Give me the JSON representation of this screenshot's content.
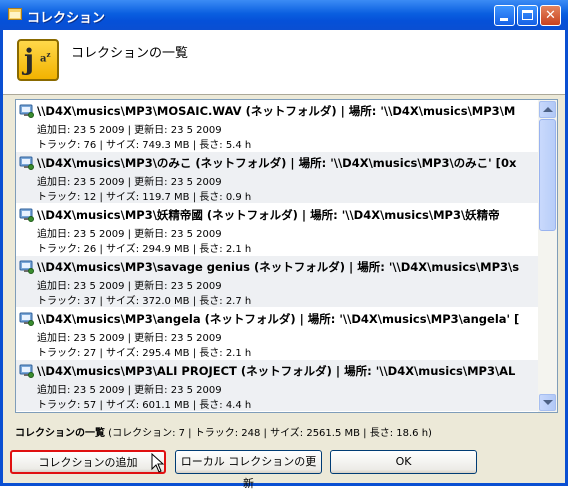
{
  "window": {
    "title": "コレクション"
  },
  "header": {
    "title": "コレクションの一覧",
    "icon": "jaz-app-icon"
  },
  "collections": [
    {
      "path": "\\\\D4X\\musics\\MP3\\MOSAIC.WAV (ネットフォルダ) | 場所: '\\\\D4X\\musics\\MP3\\M",
      "dates": "追加日: 23 5 2009 | 更新日: 23 5 2009",
      "stats": "トラック: 76 | サイズ: 749.3 MB | 長さ: 5.4 h"
    },
    {
      "path": "\\\\D4X\\musics\\MP3\\のみこ (ネットフォルダ) | 場所: '\\\\D4X\\musics\\MP3\\のみこ' [0x",
      "dates": "追加日: 23 5 2009 | 更新日: 23 5 2009",
      "stats": "トラック: 12 | サイズ: 119.7 MB | 長さ: 0.9 h"
    },
    {
      "path": "\\\\D4X\\musics\\MP3\\妖精帝國 (ネットフォルダ) | 場所: '\\\\D4X\\musics\\MP3\\妖精帝",
      "dates": "追加日: 23 5 2009 | 更新日: 23 5 2009",
      "stats": "トラック: 26 | サイズ: 294.9 MB | 長さ: 2.1 h"
    },
    {
      "path": "\\\\D4X\\musics\\MP3\\savage genius (ネットフォルダ) | 場所: '\\\\D4X\\musics\\MP3\\s",
      "dates": "追加日: 23 5 2009 | 更新日: 23 5 2009",
      "stats": "トラック: 37 | サイズ: 372.0 MB | 長さ: 2.7 h"
    },
    {
      "path": "\\\\D4X\\musics\\MP3\\angela (ネットフォルダ) | 場所: '\\\\D4X\\musics\\MP3\\angela' [",
      "dates": "追加日: 23 5 2009 | 更新日: 23 5 2009",
      "stats": "トラック: 27 | サイズ: 295.4 MB | 長さ: 2.1 h"
    },
    {
      "path": "\\\\D4X\\musics\\MP3\\ALI PROJECT (ネットフォルダ) | 場所: '\\\\D4X\\musics\\MP3\\AL",
      "dates": "追加日: 23 5 2009 | 更新日: 23 5 2009",
      "stats": "トラック: 57 | サイズ: 601.1 MB | 長さ: 4.4 h"
    }
  ],
  "summary": {
    "label": "コレクションの一覧",
    "details": " (コレクション: 7 | トラック: 248 | サイズ: 2561.5 MB | 長さ: 18.6 h)"
  },
  "buttons": {
    "add": "コレクションの追加",
    "update": "ローカル コレクションの更新",
    "ok": "OK"
  }
}
